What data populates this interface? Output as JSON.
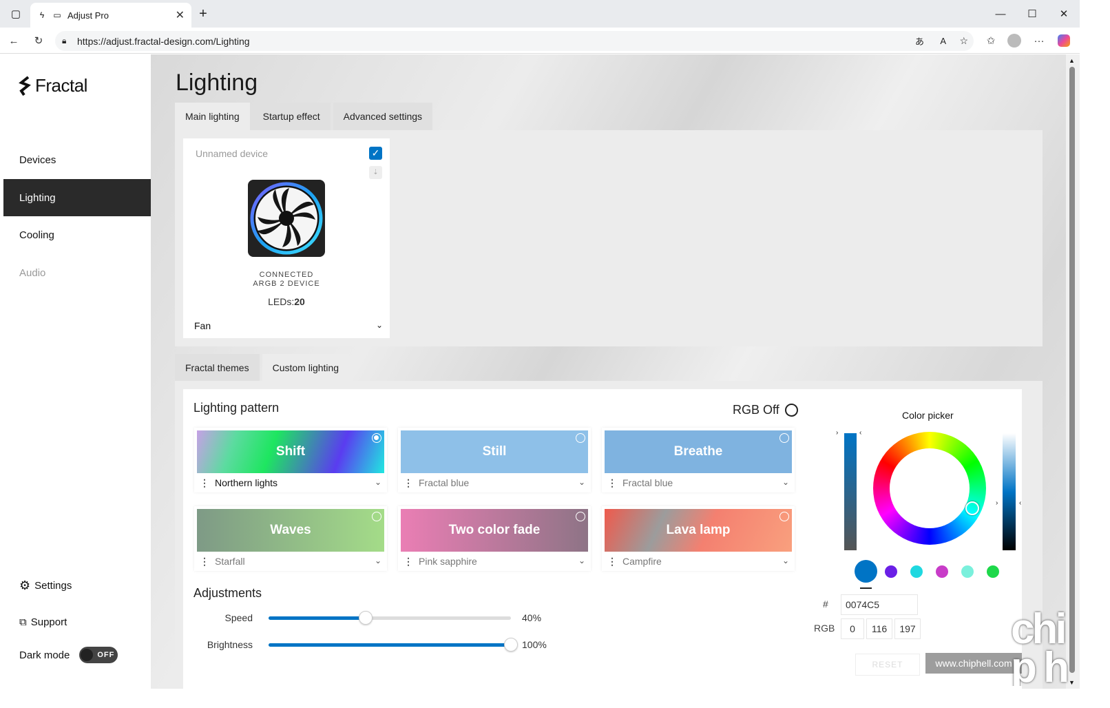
{
  "browser": {
    "tab_title": "Adjust Pro",
    "url": "https://adjust.fractal-design.com/Lighting"
  },
  "sidebar": {
    "logo": "Fractal",
    "nav": [
      "Devices",
      "Lighting",
      "Cooling",
      "Audio"
    ],
    "settings": "Settings",
    "support": "Support",
    "dark_mode_label": "Dark mode",
    "dark_mode_state": "OFF"
  },
  "page": {
    "title": "Lighting",
    "tabs": [
      "Main lighting",
      "Startup effect",
      "Advanced settings"
    ],
    "lower_tabs": [
      "Fractal themes",
      "Custom lighting"
    ]
  },
  "device": {
    "name_placeholder": "Unnamed device",
    "status": "CONNECTED",
    "type": "ARGB 2 DEVICE",
    "leds_label": "LEDs:",
    "leds_value": "20",
    "selected": "Fan",
    "checked": true
  },
  "lighting_pattern": {
    "title": "Lighting pattern",
    "rgb_off": "RGB Off",
    "patterns": [
      {
        "name": "Shift",
        "preset": "Northern lights",
        "selected": true
      },
      {
        "name": "Still",
        "preset": "Fractal blue",
        "selected": false
      },
      {
        "name": "Breathe",
        "preset": "Fractal blue",
        "selected": false
      },
      {
        "name": "Waves",
        "preset": "Starfall",
        "selected": false
      },
      {
        "name": "Two color fade",
        "preset": "Pink sapphire",
        "selected": false
      },
      {
        "name": "Lava lamp",
        "preset": "Campfire",
        "selected": false
      }
    ]
  },
  "adjustments": {
    "title": "Adjustments",
    "speed_label": "Speed",
    "speed_value": "40%",
    "speed_fraction": 0.4,
    "brightness_label": "Brightness",
    "brightness_value": "100%",
    "brightness_fraction": 1.0
  },
  "color_picker": {
    "title": "Color picker",
    "hash": "#",
    "hex": "0074C5",
    "rgb_label": "RGB",
    "r": "0",
    "g": "116",
    "b": "197",
    "reset": "RESET",
    "swatches": [
      "#0074c5",
      "#6a1fe6",
      "#1fd8e0",
      "#c83cc8",
      "#7af0dc",
      "#1ed84a"
    ]
  },
  "watermark": {
    "text": "www.chiphell.com",
    "logo": "chip hell"
  }
}
